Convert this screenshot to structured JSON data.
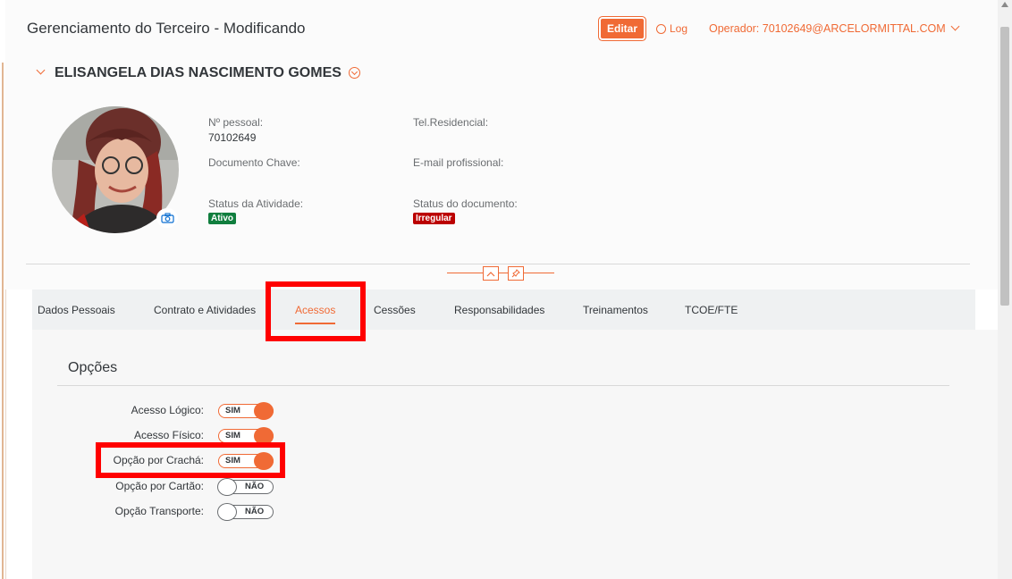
{
  "header": {
    "title": "Gerenciamento do Terceiro - Modificando",
    "edit_label": "Editar",
    "log_label": "Log",
    "operator_label": "Operador: 70102649@ARCELORMITTAL.COM"
  },
  "person": {
    "name": "ELISANGELA DIAS NASCIMENTO GOMES",
    "fields": {
      "personal_no_label": "Nº pessoal:",
      "personal_no_value": "70102649",
      "key_doc_label": "Documento Chave:",
      "activity_status_label": "Status da Atividade:",
      "activity_status_value": "Ativo",
      "home_phone_label": "Tel.Residencial:",
      "work_email_label": "E-mail profissional:",
      "doc_status_label": "Status do documento:",
      "doc_status_value": "Irregular"
    }
  },
  "tabs": [
    {
      "label": "Dados Pessoais"
    },
    {
      "label": "Contrato e Atividades"
    },
    {
      "label": "Acessos",
      "active": true
    },
    {
      "label": "Cessões"
    },
    {
      "label": "Responsabilidades"
    },
    {
      "label": "Treinamentos"
    },
    {
      "label": "TCOE/FTE"
    }
  ],
  "options": {
    "title": "Opções",
    "items": [
      {
        "label": "Acesso Lógico:",
        "state": "SIM",
        "on": true
      },
      {
        "label": "Acesso Físico:",
        "state": "SIM",
        "on": true
      },
      {
        "label": "Opção por Crachá:",
        "state": "SIM",
        "on": true
      },
      {
        "label": "Opção por Cartão:",
        "state": "NÃO",
        "on": false
      },
      {
        "label": "Opção Transporte:",
        "state": "NÃO",
        "on": false
      }
    ]
  },
  "colors": {
    "accent": "#f06a35",
    "active_badge": "#107e3e",
    "irregular_badge": "#bb0000",
    "highlight": "#ff0000"
  },
  "icons": [
    "user-search-icon",
    "chevron-down-icon",
    "circle-chevron-down-icon",
    "camera-icon",
    "collapse-up-icon",
    "pin-icon"
  ]
}
